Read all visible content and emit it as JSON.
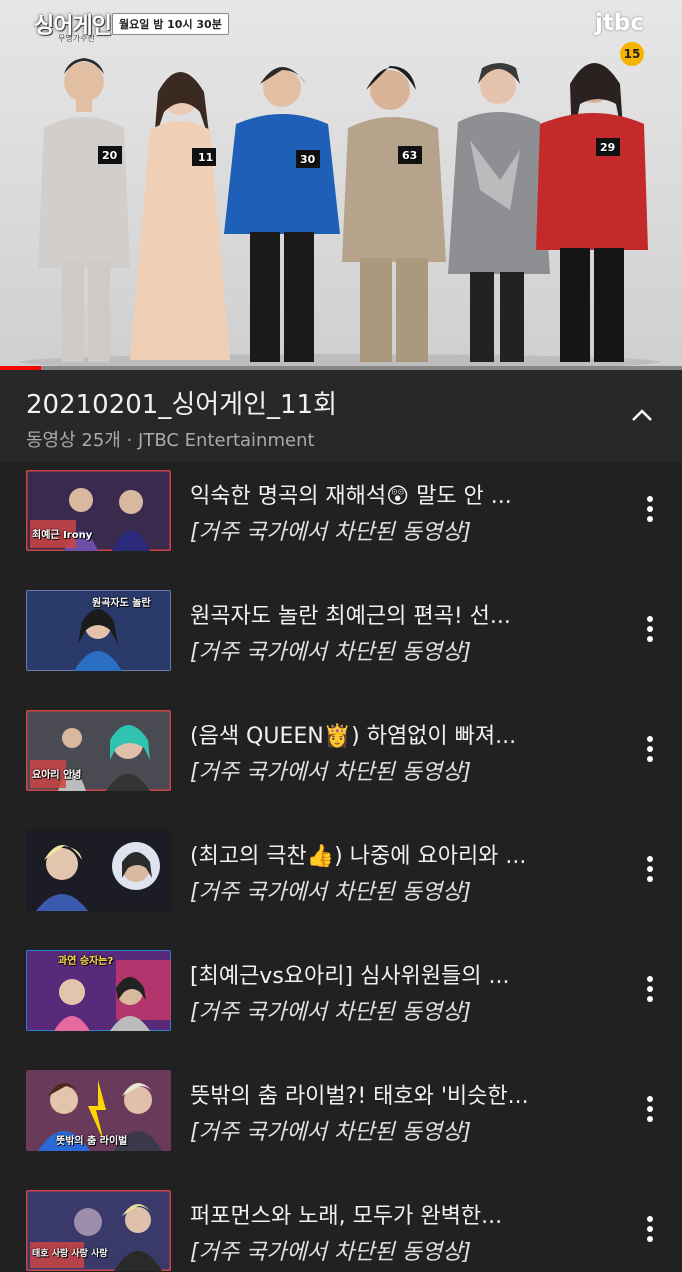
{
  "player": {
    "show_logo": "싱어게인",
    "show_sub": "무명가수전",
    "airtime": "월요일 밤 10시 30분",
    "channel": "jtbc",
    "age_rating": "15",
    "contestant_numbers": [
      "20",
      "11",
      "30",
      "63",
      "",
      "29"
    ],
    "progress": 0.06,
    "accent_color": "#ff0000"
  },
  "playlist": {
    "title": "20210201_싱어게인_11회",
    "meta": "동영상 25개 · JTBC Entertainment",
    "collapse_icon": "chevron-up-icon"
  },
  "items": [
    {
      "title": "익숙한 명곡의 재해석😲 말도 안 ...",
      "status": "[거주 국가에서 차단된 동영상]",
      "thumb_caption": "최예근 Irony"
    },
    {
      "title": "원곡자도 놀란 최예근의 편곡! 선...",
      "status": "[거주 국가에서 차단된 동영상]",
      "thumb_caption": "원곡자도 놀란"
    },
    {
      "title": "(음색 QUEEN👸) 하염없이 빠져...",
      "status": "[거주 국가에서 차단된 동영상]",
      "thumb_caption": "요아리 안녕"
    },
    {
      "title": "(최고의 극찬👍) 나중에 요아리와 ...",
      "status": "[거주 국가에서 차단된 동영상]",
      "thumb_caption": ""
    },
    {
      "title": "[최예근vs요아리] 심사위원들의 ...",
      "status": "[거주 국가에서 차단된 동영상]",
      "thumb_caption": "과연 승자는?"
    },
    {
      "title": "뜻밖의 춤 라이벌?! 태호와 '비슷한...",
      "status": "[거주 국가에서 차단된 동영상]",
      "thumb_caption": "뜻밖의 춤 라이벌"
    },
    {
      "title": "퍼포먼스와 노래, 모두가 완벽한...",
      "status": "[거주 국가에서 차단된 동영상]",
      "thumb_caption": "태호 사랑 사랑 사랑"
    }
  ]
}
